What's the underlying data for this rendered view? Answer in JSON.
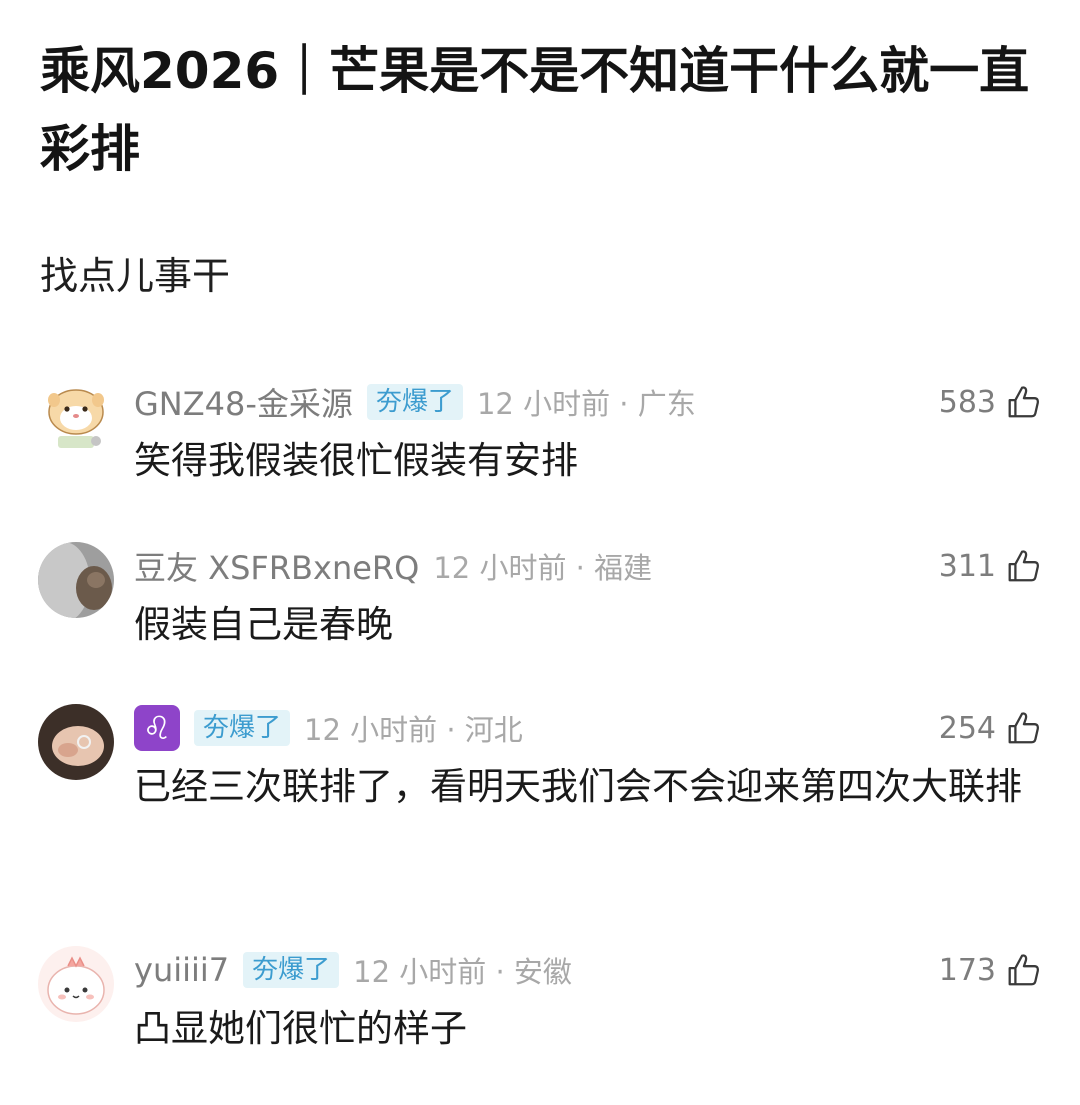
{
  "post": {
    "title": "乘风2026｜芒果是不是不知道干什么就一直彩排",
    "body": "找点儿事干"
  },
  "comments": [
    {
      "username": "GNZ48-金采源",
      "badge": "夯爆了",
      "time_location": "12 小时前 · 广东",
      "likes": "583",
      "text": "笑得我假装很忙假装有安排"
    },
    {
      "username": "豆友 XSFRBxneRQ",
      "badge": "",
      "time_location": "12 小时前 · 福建",
      "likes": "311",
      "text": "假装自己是春晚"
    },
    {
      "username": "",
      "badge": "夯爆了",
      "time_location": "12 小时前 · 河北",
      "likes": "254",
      "text": "已经三次联排了，看明天我们会不会迎来第四次大联排"
    },
    {
      "username": "yuiiii7",
      "badge": "夯爆了",
      "time_location": "12 小时前 · 安徽",
      "likes": "173",
      "text": "凸显她们很忙的样子"
    }
  ],
  "icons": {
    "like": "thumbs-up-icon",
    "zodiac": "leo-zodiac-icon"
  },
  "colors": {
    "badge_text": "#3c9ccf",
    "badge_bg": "#e3f3f8",
    "zodiac_bg": "#8e44c9"
  }
}
